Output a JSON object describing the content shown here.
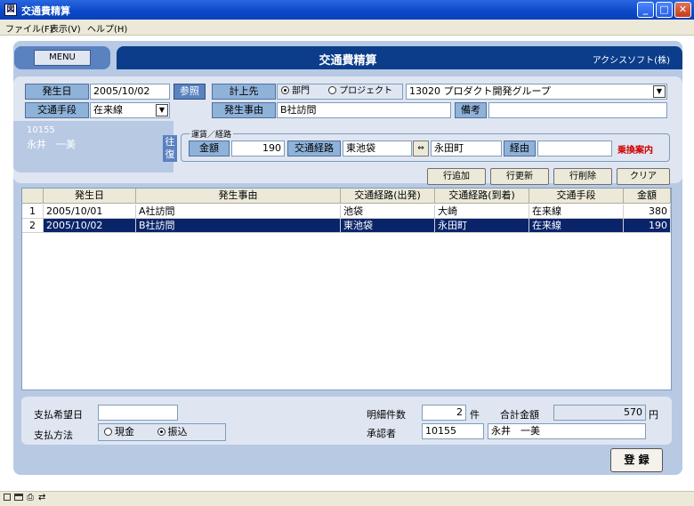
{
  "window": {
    "app_icon_glyph": "図",
    "title": "交通費精算"
  },
  "menubar": {
    "items": [
      "ファイル(F)",
      "表示(V)",
      "ヘルプ(H)"
    ]
  },
  "banner": {
    "menu_label": "MENU",
    "title": "交通費精算",
    "company": "アクシスソフト(株)"
  },
  "header": {
    "date_label": "発生日",
    "date_value": "2005/10/02",
    "ref_button": "参照",
    "post_label": "計上先",
    "post_radio_dept": "部門",
    "post_radio_project": "プロジェクト",
    "post_value": "13020  プロダクト開発グループ",
    "transport_label": "交通手段",
    "transport_value": "在来線",
    "reason_label": "発生事由",
    "reason_value": "B社訪問",
    "note_label": "備考",
    "note_value": "",
    "employee_id": "10155",
    "employee_name": "永井　一美"
  },
  "fare": {
    "group_label": "運賃／経路",
    "roundtrip_label": "往\n復",
    "amount_label": "金額",
    "amount_value": "190",
    "route_label": "交通経路",
    "route_from": "東池袋",
    "swap_glyph": "⇔",
    "route_to": "永田町",
    "via_label": "経由",
    "via_value": "",
    "transfer_guide": "乗換案内"
  },
  "actions": {
    "add": "行追加",
    "update": "行更新",
    "delete": "行削除",
    "clear": "クリア"
  },
  "grid": {
    "headers": [
      "",
      "発生日",
      "発生事由",
      "交通経路(出発)",
      "交通経路(到着)",
      "交通手段",
      "金額"
    ],
    "rows": [
      [
        "1",
        "2005/10/01",
        "A社訪問",
        "池袋",
        "大崎",
        "在来線",
        "380"
      ],
      [
        "2",
        "2005/10/02",
        "B社訪問",
        "東池袋",
        "永田町",
        "在来線",
        "190"
      ]
    ],
    "selected_row": 2
  },
  "footer": {
    "pay_date_label": "支払希望日",
    "pay_date_value": "",
    "pay_method_label": "支払方法",
    "pay_cash": "現金",
    "pay_transfer": "振込",
    "count_label": "明細件数",
    "count_value": "2",
    "count_unit": "件",
    "total_label": "合計金額",
    "total_value": "570",
    "total_unit": "円",
    "approver_label": "承認者",
    "approver_id": "10155",
    "approver_name": "永井　一美",
    "register_button": "登 録"
  },
  "colors": {
    "titlebar": "#0a48c8",
    "banner": "#0b3d8a",
    "selection": "#0a246a",
    "panel": "#b8c9e4",
    "label": "#8fb2d8"
  }
}
